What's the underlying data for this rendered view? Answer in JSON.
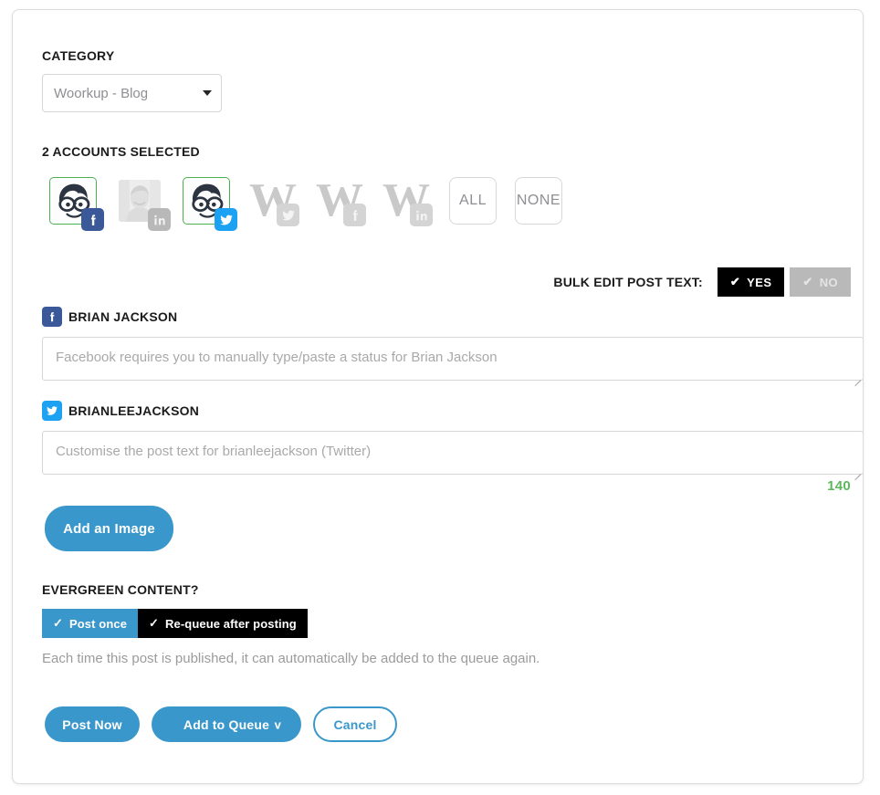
{
  "category": {
    "label": "CATEGORY",
    "selected": "Woorkup - Blog",
    "caret_icon": "chevron-down-icon"
  },
  "accounts": {
    "label": "2 ACCOUNTS SELECTED",
    "items": [
      {
        "name": "Brian Jackson",
        "network": "facebook",
        "selected": true,
        "avatar": "nerd"
      },
      {
        "name": "Brian Jackson",
        "network": "linkedin",
        "selected": false,
        "avatar": "photo"
      },
      {
        "name": "brianleejackson",
        "network": "twitter",
        "selected": true,
        "avatar": "nerd"
      },
      {
        "name": "Woorkup",
        "network": "twitter",
        "selected": false,
        "avatar": "w"
      },
      {
        "name": "Woorkup",
        "network": "facebook",
        "selected": false,
        "avatar": "w"
      },
      {
        "name": "Woorkup",
        "network": "linkedin",
        "selected": false,
        "avatar": "w"
      }
    ],
    "all_label": "ALL",
    "none_label": "NONE",
    "selected_border_color": "#4caf50"
  },
  "bulk_edit": {
    "label": "BULK EDIT POST TEXT:",
    "yes_label": "YES",
    "no_label": "NO",
    "check_glyph": "✔",
    "active": "yes"
  },
  "posts": [
    {
      "handle": "BRIAN JACKSON",
      "network": "facebook",
      "network_color": "#3b5998",
      "placeholder": "Facebook requires you to manually type/paste a status for Brian Jackson",
      "value": ""
    },
    {
      "handle": "BRIANLEEJACKSON",
      "network": "twitter",
      "network_color": "#1da1f2",
      "placeholder": "Customise the post text for brianleejackson (Twitter)",
      "value": ""
    }
  ],
  "char_count": "140",
  "char_count_color": "#5bb85b",
  "add_image": {
    "label": "Add an Image"
  },
  "evergreen": {
    "label": "EVERGREEN CONTENT?",
    "post_once_label": "Post once",
    "requeue_label": "Re-queue after posting",
    "check_glyph": "✓",
    "description": "Each time this post is published, it can automatically be added to the queue again.",
    "active": "requeue"
  },
  "footer": {
    "post_now_label": "Post Now",
    "add_to_queue_label": "Add to Queue",
    "add_to_queue_caret": "v",
    "cancel_label": "Cancel"
  },
  "theme": {
    "accent": "#3a97cb",
    "facebook": "#3b5998",
    "twitter": "#1da1f2",
    "linkedin_muted": "#b8b8b8",
    "black": "#000000",
    "muted_gray": "#b9b9b9"
  }
}
